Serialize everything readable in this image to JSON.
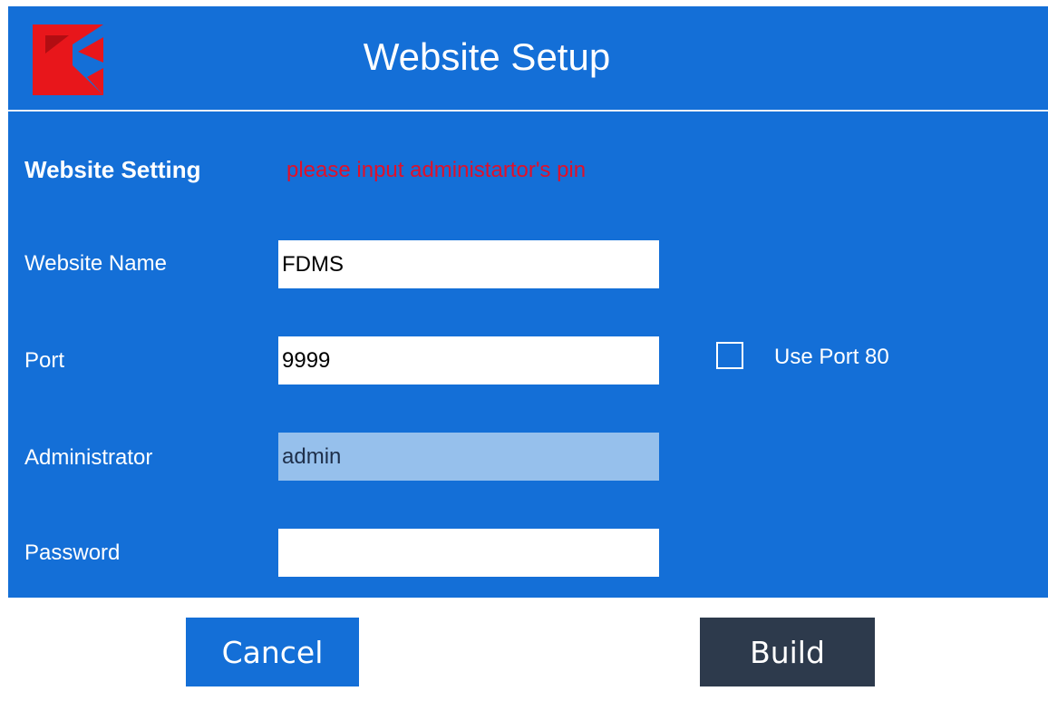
{
  "dialog": {
    "title": "Website Setup",
    "logo": "app-logo"
  },
  "section": {
    "title": "Website Setting",
    "warning": "please input administartor's pin"
  },
  "form": {
    "website_name": {
      "label": "Website Name",
      "value": "FDMS"
    },
    "port": {
      "label": "Port",
      "value": "9999"
    },
    "use_port_80": {
      "label": "Use Port 80",
      "checked": false
    },
    "administrator": {
      "label": "Administrator",
      "value": "admin"
    },
    "password": {
      "label": "Password",
      "value": ""
    }
  },
  "buttons": {
    "cancel": "Cancel",
    "build": "Build"
  },
  "colors": {
    "panel": "#146fd7",
    "warning": "#e0102a",
    "build_button": "#2d3a4c",
    "readonly_field": "#96c0ec",
    "logo": "#e8161b"
  }
}
